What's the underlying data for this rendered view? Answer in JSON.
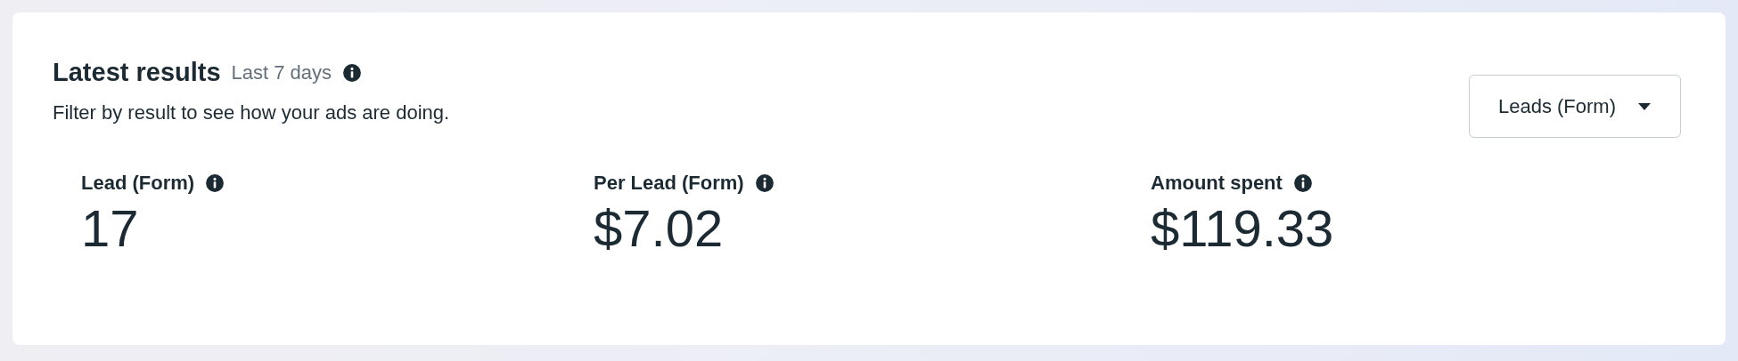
{
  "header": {
    "title": "Latest results",
    "period": "Last 7 days",
    "description": "Filter by result to see how your ads are doing."
  },
  "filter_dropdown": {
    "value": "Leads (Form)"
  },
  "metrics": [
    {
      "label": "Lead (Form)",
      "value": "17"
    },
    {
      "label": "Per Lead (Form)",
      "value": "$7.02"
    },
    {
      "label": "Amount spent",
      "value": "$119.33"
    }
  ]
}
